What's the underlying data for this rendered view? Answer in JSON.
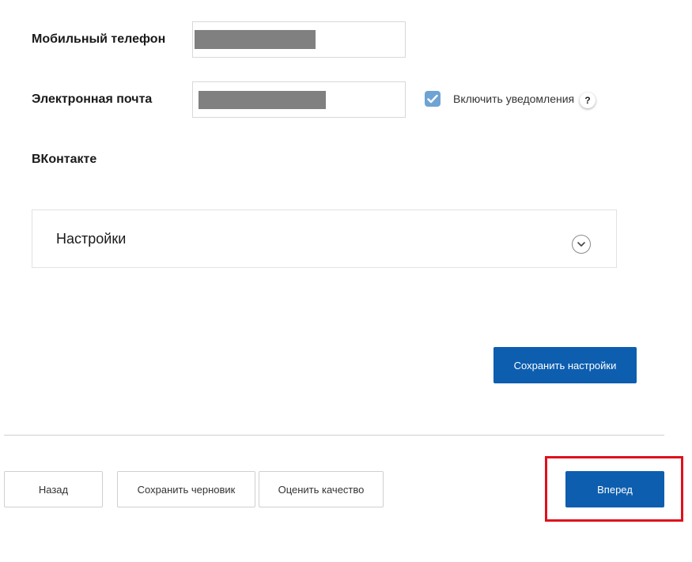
{
  "contacts": {
    "phone_label": "Мобильный телефон",
    "email_label": "Электронная почта",
    "notifications_label": "Включить уведомления",
    "notifications_checked": true,
    "help_symbol": "?",
    "vk_label": "ВКонтакте"
  },
  "settings_panel": {
    "title": "Настройки",
    "expanded": false
  },
  "buttons": {
    "save_settings": "Сохранить настройки",
    "back": "Назад",
    "save_draft": "Сохранить черновик",
    "rate_quality": "Оценить качество",
    "next": "Вперед"
  },
  "colors": {
    "primary": "#0d5eaf",
    "checkbox": "#6ea3d4",
    "highlight": "#e0101c",
    "redaction": "#808080"
  }
}
